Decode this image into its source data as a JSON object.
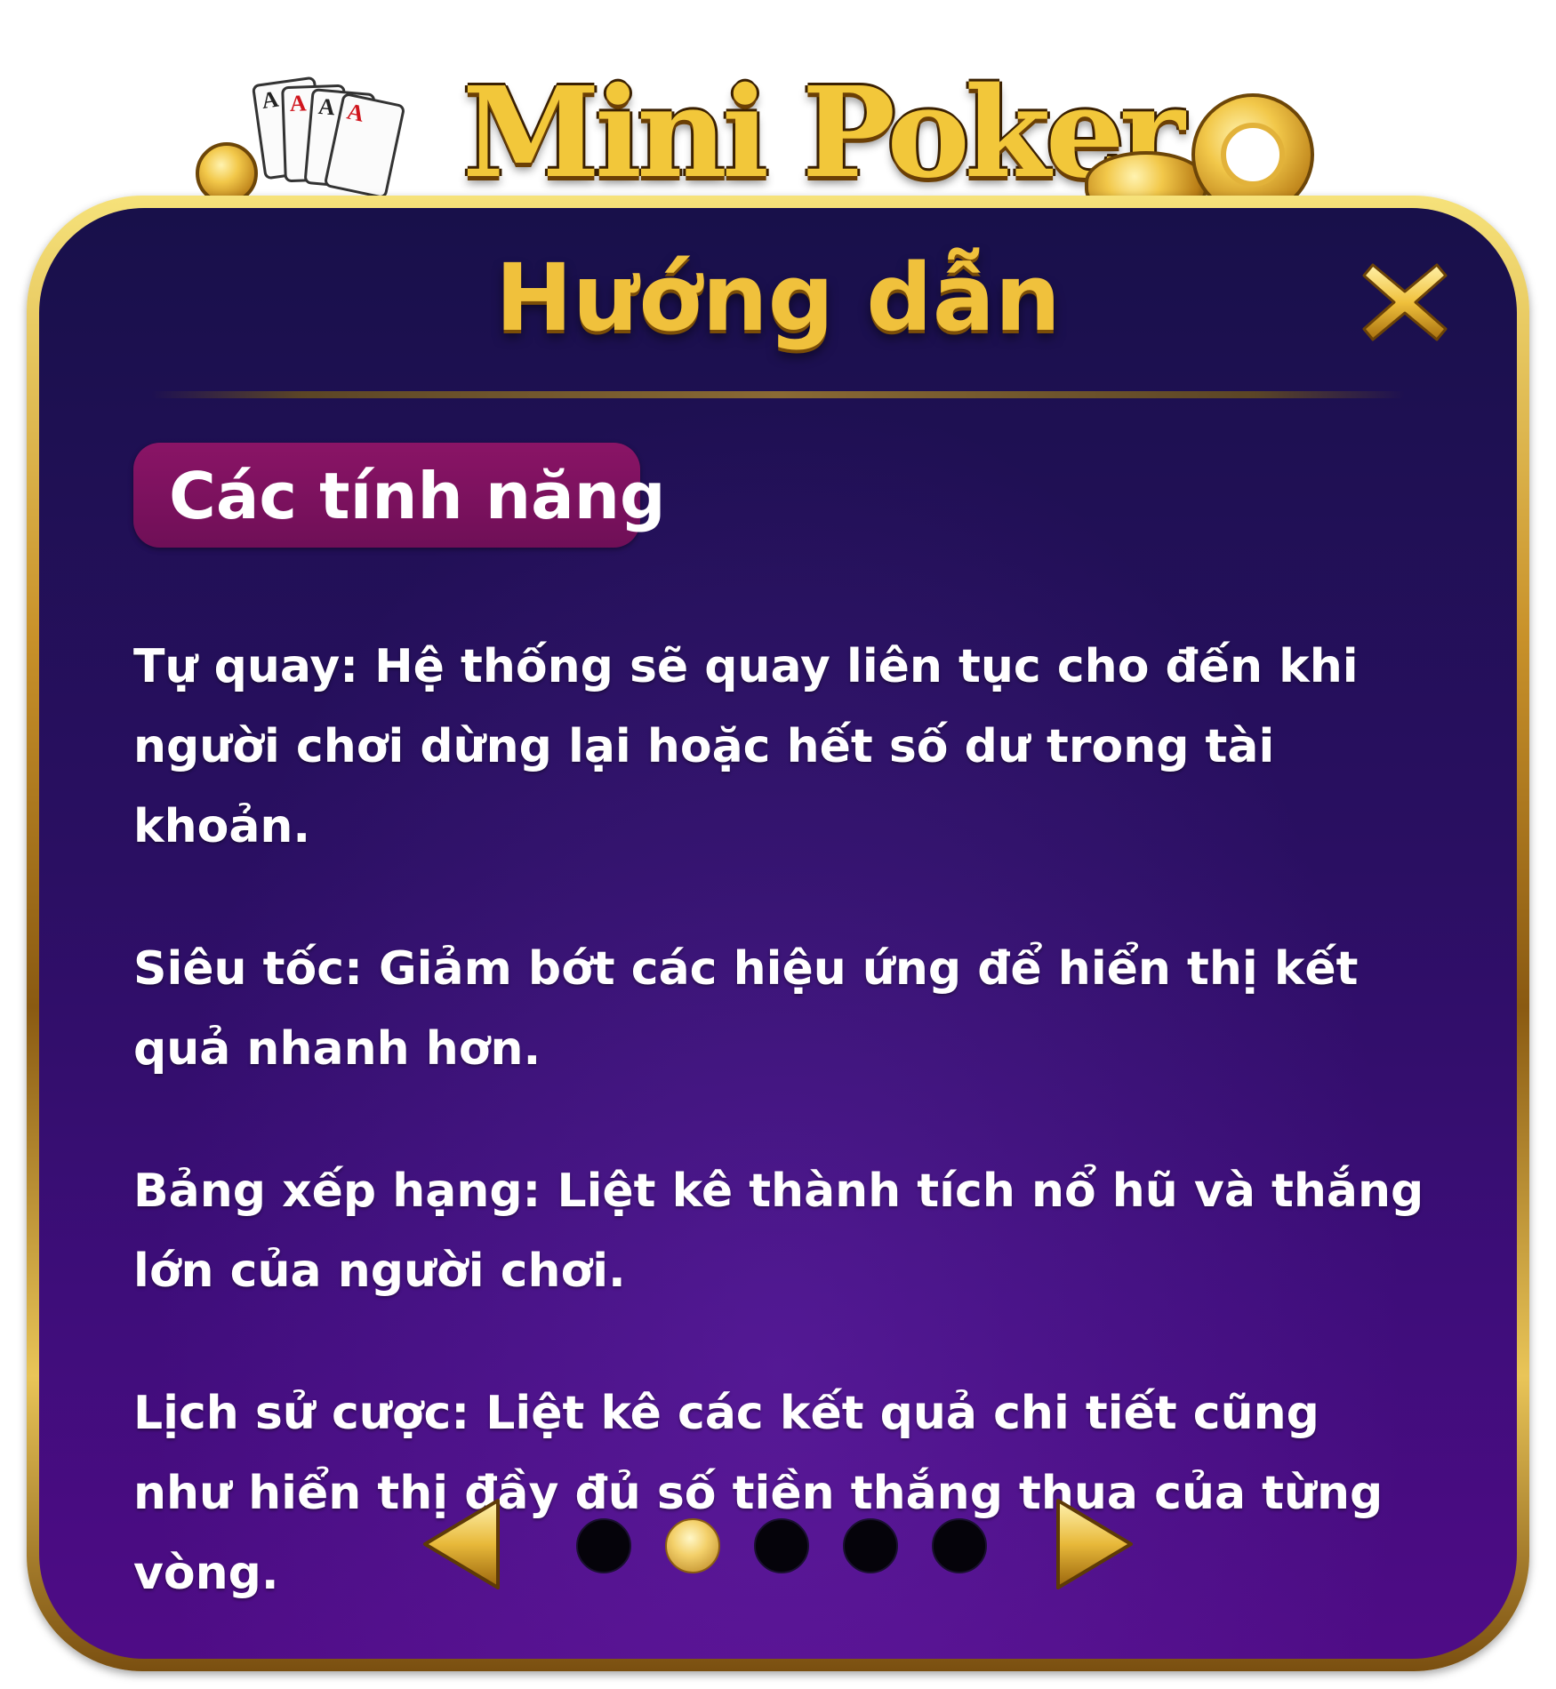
{
  "logo": {
    "text": "Mini Poker",
    "cards": [
      "A",
      "A",
      "A",
      "A"
    ]
  },
  "dialog": {
    "title": "Hướng dẫn",
    "close_icon": "close-x-icon",
    "section_title": "Các tính năng",
    "features": [
      "Tự quay: Hệ thống sẽ quay liên tục cho đến khi người chơi dừng lại hoặc hết số dư trong tài khoản.",
      "Siêu tốc: Giảm bớt các hiệu ứng để hiển thị kết quả nhanh hơn.",
      "Bảng xếp hạng: Liệt kê thành tích nổ hũ và thắng lớn của người chơi.",
      "Lịch sử cược: Liệt kê các kết quả chi tiết cũng như hiển thị đầy đủ số tiền thắng thua của từng vòng."
    ]
  },
  "pager": {
    "total_pages": 5,
    "current_page": 2
  },
  "colors": {
    "gold": "#f0c13c",
    "panel_top": "#18104a",
    "panel_bottom": "#4f0c86",
    "section_pill": "#7a1260",
    "text": "#ffffff",
    "dot_inactive": "#05030a"
  }
}
